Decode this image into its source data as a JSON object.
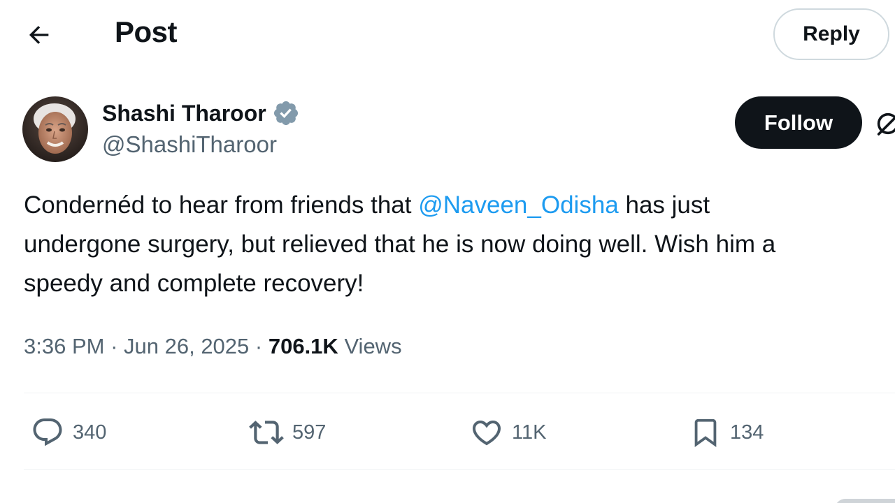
{
  "header": {
    "back_icon": "arrow-left-icon",
    "title": "Post",
    "reply_label": "Reply"
  },
  "author": {
    "name": "Shashi Tharoor",
    "handle": "@ShashiTharoor",
    "verified_icon": "verified-badge-icon",
    "verified_color": "#829aab"
  },
  "follow_label": "Follow",
  "grok_icon": "grok-icon",
  "post": {
    "line1_before": "Condernéd to hear from friends that ",
    "mention": "@Naveen_Odisha",
    "line1_after": " has just",
    "line2": "undergone surgery, but relieved that he is now doing well. Wish him a",
    "line3": "speedy and complete recovery!"
  },
  "meta": {
    "time": "3:36 PM",
    "separator": " · ",
    "date": "Jun 26, 2025",
    "views_count": "706.1K",
    "views_label": "Views"
  },
  "actions": {
    "replies": "340",
    "reposts": "597",
    "likes": "11K",
    "bookmarks": "134"
  },
  "colors": {
    "text": "#0f1419",
    "secondary": "#536471",
    "link": "#1d9bf0",
    "border": "#cfd9de"
  }
}
